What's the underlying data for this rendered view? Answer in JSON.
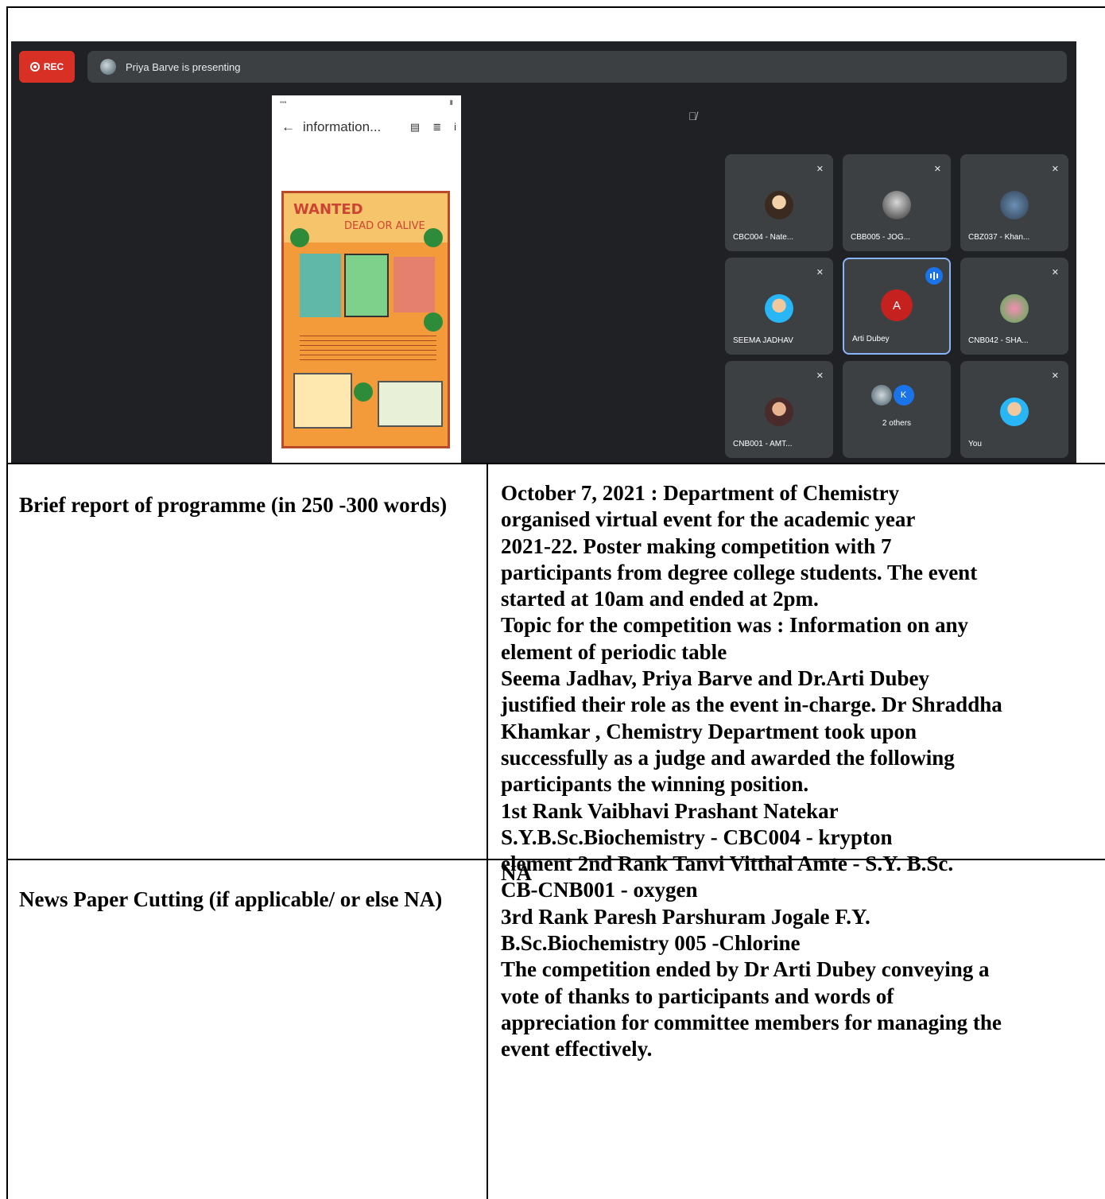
{
  "meet": {
    "rec_label": "REC",
    "presenting_text": "Priya Barve is presenting",
    "shared_doc_title": "information...",
    "poster_heading": "WANTED",
    "poster_subheading": "DEAD OR ALIVE",
    "tiles": [
      {
        "name": "CBC004 - Nate..."
      },
      {
        "name": "CBB005 - JOG..."
      },
      {
        "name": "CBZ037 - Khan..."
      },
      {
        "name": "SEEMA JADHAV"
      },
      {
        "name": "Arti Dubey",
        "initial": "A"
      },
      {
        "name": "CNB042 - SHA..."
      },
      {
        "name": "CNB001 - AMT..."
      },
      {
        "name": "2 others",
        "initial": "K"
      },
      {
        "name": "You"
      }
    ]
  },
  "report": {
    "label": "Brief report of programme (in 250 -300 words)",
    "lines": [
      "October 7, 2021 : Department of Chemistry",
      "organised virtual event for the academic year",
      "2021-22. Poster making competition with 7",
      "participants from degree college students. The event",
      "started at 10am and ended at 2pm.",
      "Topic for the competition was : Information on any",
      "element of periodic table",
      "Seema Jadhav, Priya Barve and Dr.Arti Dubey",
      "justified their role as the event in-charge. Dr Shraddha",
      "Khamkar , Chemistry Department took upon",
      "successfully as a judge and awarded the following",
      "participants the winning position.",
      "1st Rank Vaibhavi Prashant Natekar",
      "S.Y.B.Sc.Biochemistry - CBC004 -  krypton",
      "element 2nd Rank Tanvi Vitthal Amte - S.Y. B.Sc.",
      "CB-CNB001 - oxygen",
      "3rd Rank Paresh Parshuram Jogale F.Y.",
      "B.Sc.Biochemistry 005 -Chlorine",
      "The competition ended by Dr Arti Dubey conveying a",
      "vote of thanks to participants and words of",
      "appreciation for committee members for managing the",
      "event effectively."
    ]
  },
  "news": {
    "label": "News Paper Cutting (if applicable/ or else NA)",
    "value": "NA"
  }
}
